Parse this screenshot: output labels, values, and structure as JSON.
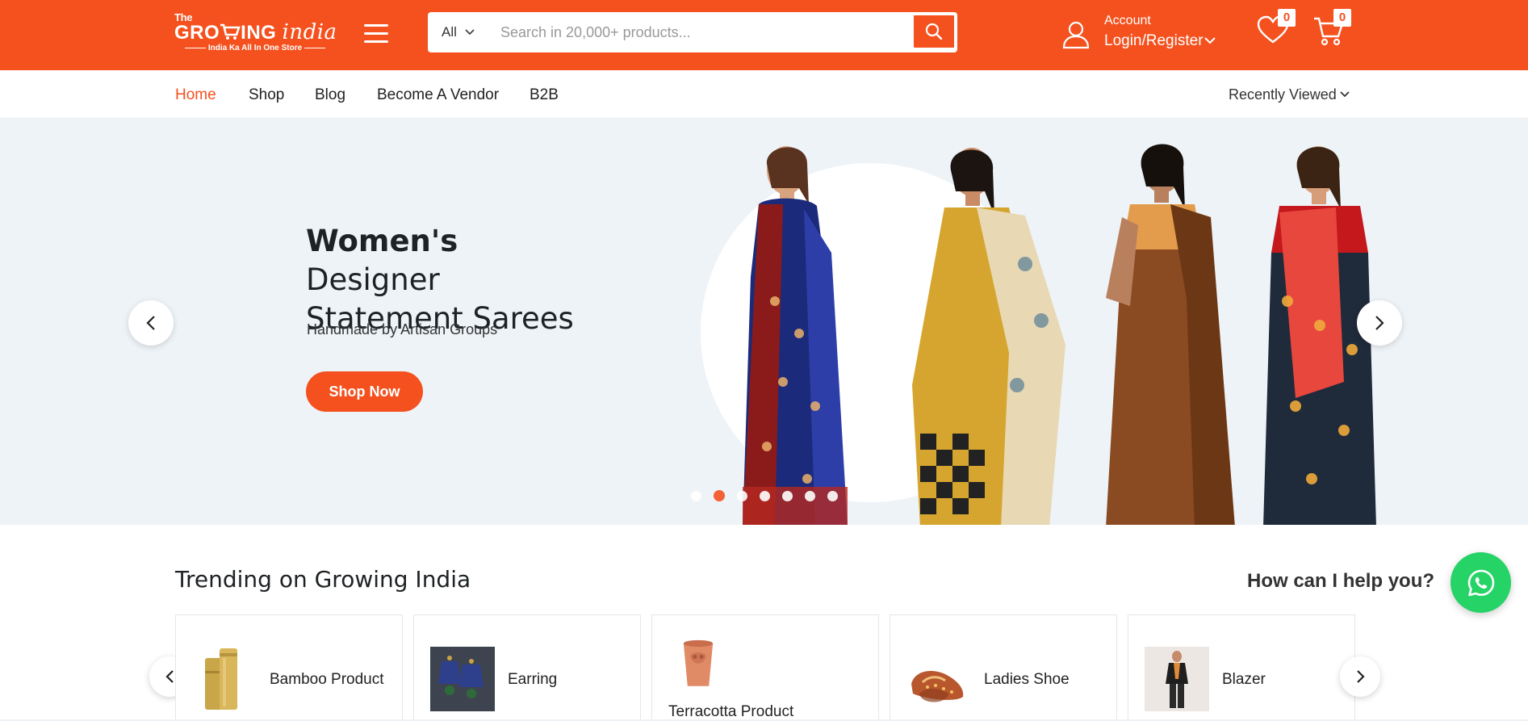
{
  "brand": {
    "logo_line1": "The",
    "logo_line2_a": "GRO",
    "logo_line2_b": "ING",
    "logo_line2_c": "india",
    "tagline": "India Ka All In One Store",
    "primary_color": "#f4511e"
  },
  "search": {
    "category": "All",
    "placeholder": "Search in 20,000+ products..."
  },
  "account": {
    "label": "Account",
    "link": "Login/Register"
  },
  "wishlist": {
    "count": "0"
  },
  "cart": {
    "count": "0"
  },
  "nav": {
    "items": [
      {
        "label": "Home",
        "active": true
      },
      {
        "label": "Shop"
      },
      {
        "label": "Blog"
      },
      {
        "label": "Become A Vendor"
      },
      {
        "label": "B2B"
      }
    ],
    "recently_viewed": "Recently Viewed"
  },
  "hero": {
    "title_bold": "Women's",
    "title_rest": "Designer Statement Sarees",
    "subtitle": "Handmade by Artisan Groups",
    "cta": "Shop Now",
    "slide_count": 7,
    "active_slide": 2
  },
  "trending": {
    "title": "Trending on Growing India",
    "categories": [
      {
        "name": "Bamboo Product",
        "icon": "bamboo-bottle-image"
      },
      {
        "name": "Earring",
        "icon": "earring-image"
      },
      {
        "name": "Terracotta Product",
        "icon": "terracotta-cup-image"
      },
      {
        "name": "Ladies Shoe",
        "icon": "ladies-shoe-image"
      },
      {
        "name": "Blazer",
        "icon": "blazer-image"
      }
    ]
  },
  "help": {
    "text": "How can I help you?",
    "icon": "whatsapp-icon",
    "color": "#25d366"
  }
}
